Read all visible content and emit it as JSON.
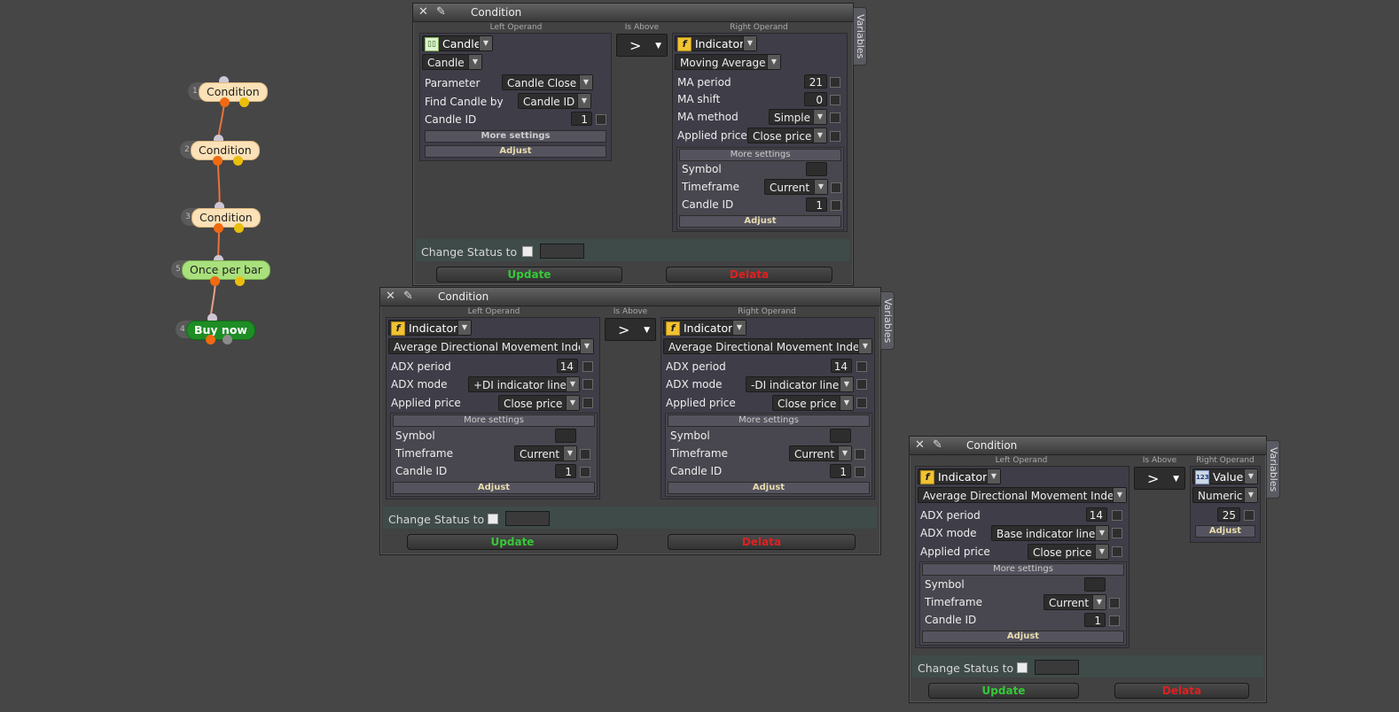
{
  "flow": {
    "nodes": [
      {
        "num": "1",
        "label": "Condition"
      },
      {
        "num": "2",
        "label": "Condition"
      },
      {
        "num": "3",
        "label": "Condition"
      },
      {
        "num": "5",
        "label": "Once per bar"
      },
      {
        "num": "4",
        "label": "Buy now"
      }
    ]
  },
  "colors": {
    "update": "#37c837",
    "delete": "#e02020",
    "condition_node": "#fbe1b7",
    "once_node": "#a9e07d",
    "buy_node": "#1e8d25"
  },
  "common": {
    "title": "Condition",
    "variables_tab": "Variables",
    "left_operand_caption": "Left Operand",
    "right_operand_caption": "Right Operand",
    "operator_caption": "Is Above",
    "operator_symbol": ">",
    "more_settings": "More settings",
    "adjust": "Adjust",
    "change_status": "Change Status to",
    "update": "Update",
    "delete": "Delata"
  },
  "w1": {
    "left": {
      "type": "Candle",
      "subtype": "Candle",
      "rows": [
        {
          "label": "Parameter",
          "value": "Candle Close"
        },
        {
          "label": "Find Candle by",
          "value": "Candle ID"
        },
        {
          "label": "Candle ID",
          "value": "1"
        }
      ]
    },
    "right": {
      "type": "Indicator",
      "indicator": "Moving Average",
      "rows": [
        {
          "label": "MA period",
          "value": "21"
        },
        {
          "label": "MA shift",
          "value": "0"
        },
        {
          "label": "MA method",
          "value": "Simple"
        },
        {
          "label": "Applied price",
          "value": "Close price"
        }
      ],
      "more": [
        {
          "label": "Symbol",
          "value": ""
        },
        {
          "label": "Timeframe",
          "value": "Current"
        },
        {
          "label": "Candle ID",
          "value": "1"
        }
      ]
    }
  },
  "w2": {
    "left": {
      "type": "Indicator",
      "indicator": "Average Directional Movement Index",
      "rows": [
        {
          "label": "ADX period",
          "value": "14"
        },
        {
          "label": "ADX mode",
          "value": "+DI indicator line"
        },
        {
          "label": "Applied price",
          "value": "Close price"
        }
      ],
      "more": [
        {
          "label": "Symbol",
          "value": ""
        },
        {
          "label": "Timeframe",
          "value": "Current"
        },
        {
          "label": "Candle ID",
          "value": "1"
        }
      ]
    },
    "right": {
      "type": "Indicator",
      "indicator": "Average Directional Movement Index",
      "rows": [
        {
          "label": "ADX period",
          "value": "14"
        },
        {
          "label": "ADX mode",
          "value": "-DI indicator line"
        },
        {
          "label": "Applied price",
          "value": "Close price"
        }
      ],
      "more": [
        {
          "label": "Symbol",
          "value": ""
        },
        {
          "label": "Timeframe",
          "value": "Current"
        },
        {
          "label": "Candle ID",
          "value": "1"
        }
      ]
    }
  },
  "w3": {
    "left": {
      "type": "Indicator",
      "indicator": "Average Directional Movement Index",
      "rows": [
        {
          "label": "ADX period",
          "value": "14"
        },
        {
          "label": "ADX mode",
          "value": "Base indicator line"
        },
        {
          "label": "Applied price",
          "value": "Close price"
        }
      ],
      "more": [
        {
          "label": "Symbol",
          "value": ""
        },
        {
          "label": "Timeframe",
          "value": "Current"
        },
        {
          "label": "Candle ID",
          "value": "1"
        }
      ]
    },
    "right": {
      "type": "Value",
      "subtype": "Numeric",
      "value": "25"
    }
  }
}
